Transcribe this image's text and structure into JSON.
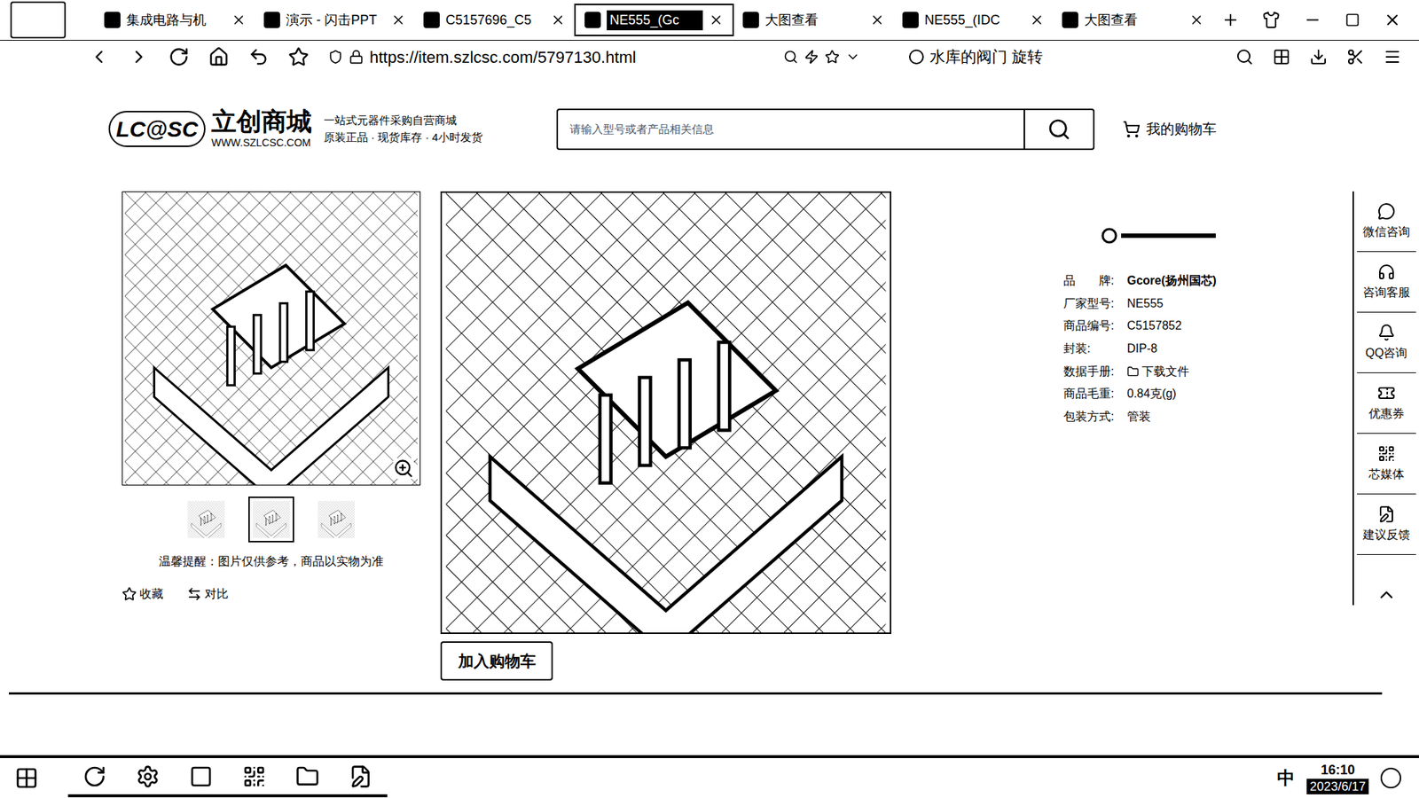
{
  "browser": {
    "tabs": [
      {
        "label": "集成电路与机",
        "selected": false
      },
      {
        "label": "演示 - 闪击PPT",
        "selected": false
      },
      {
        "label": "C5157696_C5",
        "selected": false
      },
      {
        "label": "NE555_(Gc",
        "selected": true
      },
      {
        "label": "大图查看",
        "selected": false
      },
      {
        "label": "NE555_(IDC",
        "selected": false
      },
      {
        "label": "大图查看",
        "selected": false
      }
    ],
    "url": "https://item.szlcsc.com/5797130.html",
    "search_hint": "水库的阀门 旋转"
  },
  "header": {
    "logo_mark": "LC@SC",
    "logo_name": "立创商城",
    "slogan": "一站式元器件采购自营商城",
    "subslogan": "原装正品 · 现货库存 · 4小时发货",
    "site": "WWW.SZLCSC.COM",
    "search_placeholder": "请输入型号或者产品相关信息",
    "cart": "我的购物车"
  },
  "gallery": {
    "thumbnails": [
      {
        "selected": false
      },
      {
        "selected": true
      },
      {
        "selected": false
      }
    ],
    "notice": "温馨提醒：图片仅供参考，商品以实物为准",
    "actions": [
      "收藏",
      "对比"
    ]
  },
  "add_to_cart": "加入购物车",
  "specs": [
    {
      "label": "品　　牌:",
      "value": "Gcore(扬州国芯)",
      "bold": true
    },
    {
      "label": "厂家型号:",
      "value": "NE555",
      "bold": false
    },
    {
      "label": "商品编号:",
      "value": "C5157852",
      "bold": false
    },
    {
      "label": "封装:",
      "value": "DIP-8",
      "bold": false
    },
    {
      "label": "数据手册:",
      "value": "下载文件",
      "bold": false
    },
    {
      "label": "商品毛重:",
      "value": "0.84克(g)",
      "bold": false
    },
    {
      "label": "包装方式:",
      "value": "管装",
      "bold": false
    }
  ],
  "right_rail": [
    "微信咨询",
    "咨询客服",
    "QQ咨询",
    "优惠券",
    "芯媒体",
    "建议反馈"
  ],
  "scrollbar": {
    "level": 0.98
  },
  "taskbar": {
    "ime": "中",
    "time": "16:10",
    "date": "2023/6/17"
  }
}
